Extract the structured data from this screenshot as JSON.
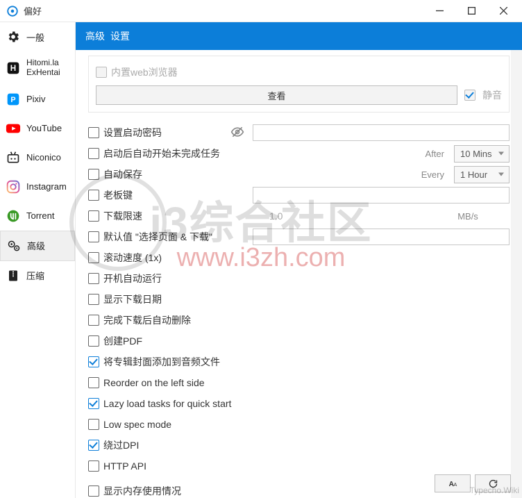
{
  "window": {
    "title": "偏好"
  },
  "sidebar": {
    "items": [
      {
        "label": "一般"
      },
      {
        "label": "Hitomi.la\nExHentai"
      },
      {
        "label": "Pixiv"
      },
      {
        "label": "YouTube"
      },
      {
        "label": "Niconico"
      },
      {
        "label": "Instagram"
      },
      {
        "label": "Torrent"
      },
      {
        "label": "高级"
      },
      {
        "label": "压缩"
      }
    ]
  },
  "header": {
    "title1": "高级",
    "title2": "设置"
  },
  "top_group": {
    "builtin_browser_label": "内置web浏览器",
    "view_button": "查看",
    "mute_label": "静音"
  },
  "rows": {
    "set_password": "设置启动密码",
    "auto_resume": "启动后自动开始未完成任务",
    "auto_save": "自动保存",
    "boss_key": "老板键",
    "speed_limit": "下载限速",
    "default_select": "默认值 \"选择页面 & 下载\"",
    "scroll_speed": "滚动速度 (1x)",
    "autostart": "开机自动运行",
    "show_date": "显示下载日期",
    "auto_delete": "完成下载后自动删除",
    "create_pdf": "创建PDF",
    "embed_cover": "将专辑封面添加到音频文件",
    "reorder_left": "Reorder on the left side",
    "lazy_load": "Lazy load tasks for quick start",
    "low_spec": "Low spec mode",
    "bypass_dpi": "绕过DPI",
    "http_api": "HTTP API",
    "show_memory": "显示内存使用情况"
  },
  "labels": {
    "after": "After",
    "every": "Every",
    "mb_s": "MB/s"
  },
  "selects": {
    "after_value": "10 Mins",
    "every_value": "1 Hour"
  },
  "values": {
    "speed_value": "1.0"
  },
  "watermarks": {
    "wm1": "i3综合社区",
    "wm2": "www.i3zh.com",
    "wm3": "Typecho.Wiki"
  }
}
